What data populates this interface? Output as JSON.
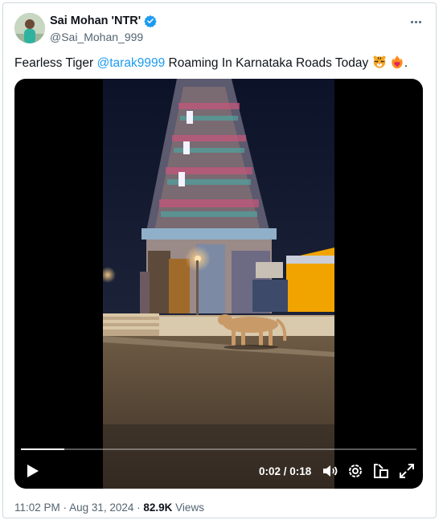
{
  "author": {
    "display_name": "Sai Mohan 'NTR'",
    "handle": "@Sai_Mohan_999"
  },
  "tweet": {
    "text_before": "Fearless Tiger ",
    "mention": "@tarak9999",
    "text_after": " Roaming In Karnataka Roads Today ",
    "text_end": "."
  },
  "video": {
    "time_current": "0:02",
    "time_separator": " / ",
    "time_total": "0:18",
    "progress": 0.11
  },
  "meta": {
    "time": "11:02 PM",
    "separator": " · ",
    "date": "Aug 31, 2024",
    "views_count": "82.9K",
    "views_label": " Views"
  },
  "colors": {
    "accent": "#1d9bf0",
    "text": "#0f1419",
    "secondary": "#536471"
  },
  "icons": [
    "verified-badge-icon",
    "more-options-icon",
    "tiger-emoji-icon",
    "heart-on-fire-emoji-icon",
    "play-icon",
    "volume-icon",
    "settings-icon",
    "picture-in-picture-icon",
    "fullscreen-icon"
  ]
}
